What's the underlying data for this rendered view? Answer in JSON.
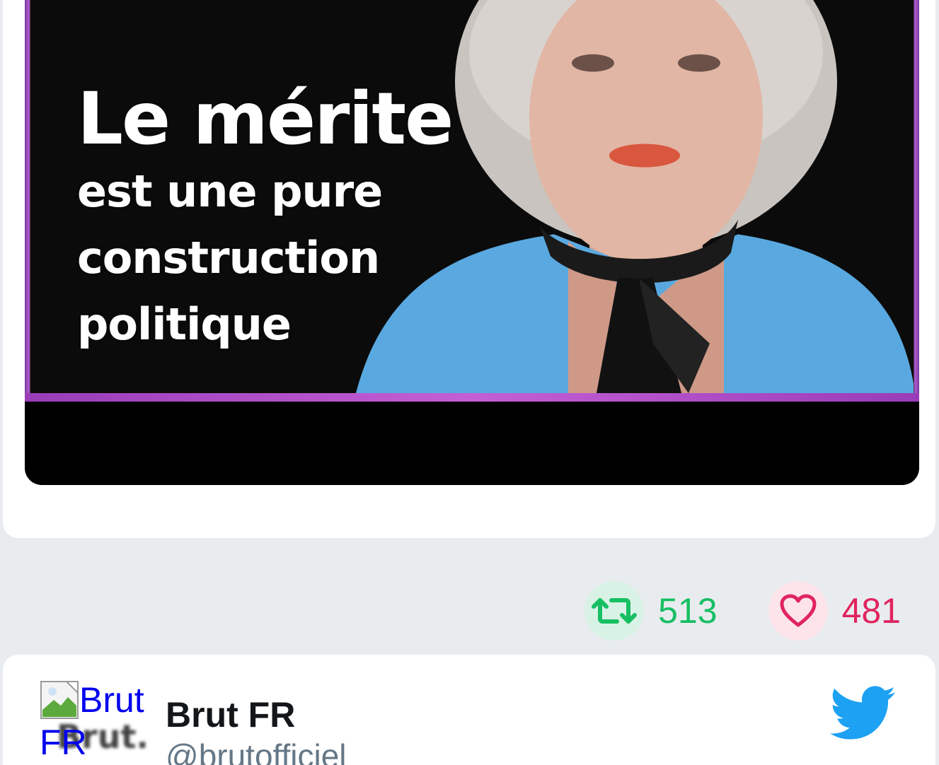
{
  "media": {
    "headline": "Le mérite",
    "line1": "est une pure",
    "line2": "construction",
    "line3": "politique"
  },
  "actions": {
    "retweets": "513",
    "likes": "481",
    "retweet_icon": "retweet-icon",
    "like_icon": "heart-icon",
    "retweet_color": "#17bf63",
    "like_color": "#e0245e"
  },
  "author": {
    "avatar_alt": "Brut FR",
    "avatar_logo_text": "Brut.",
    "name": "Brut FR",
    "handle": "@brutofficiel"
  },
  "brand": {
    "logo_icon": "twitter-bird-icon",
    "color": "#1da1f2"
  }
}
